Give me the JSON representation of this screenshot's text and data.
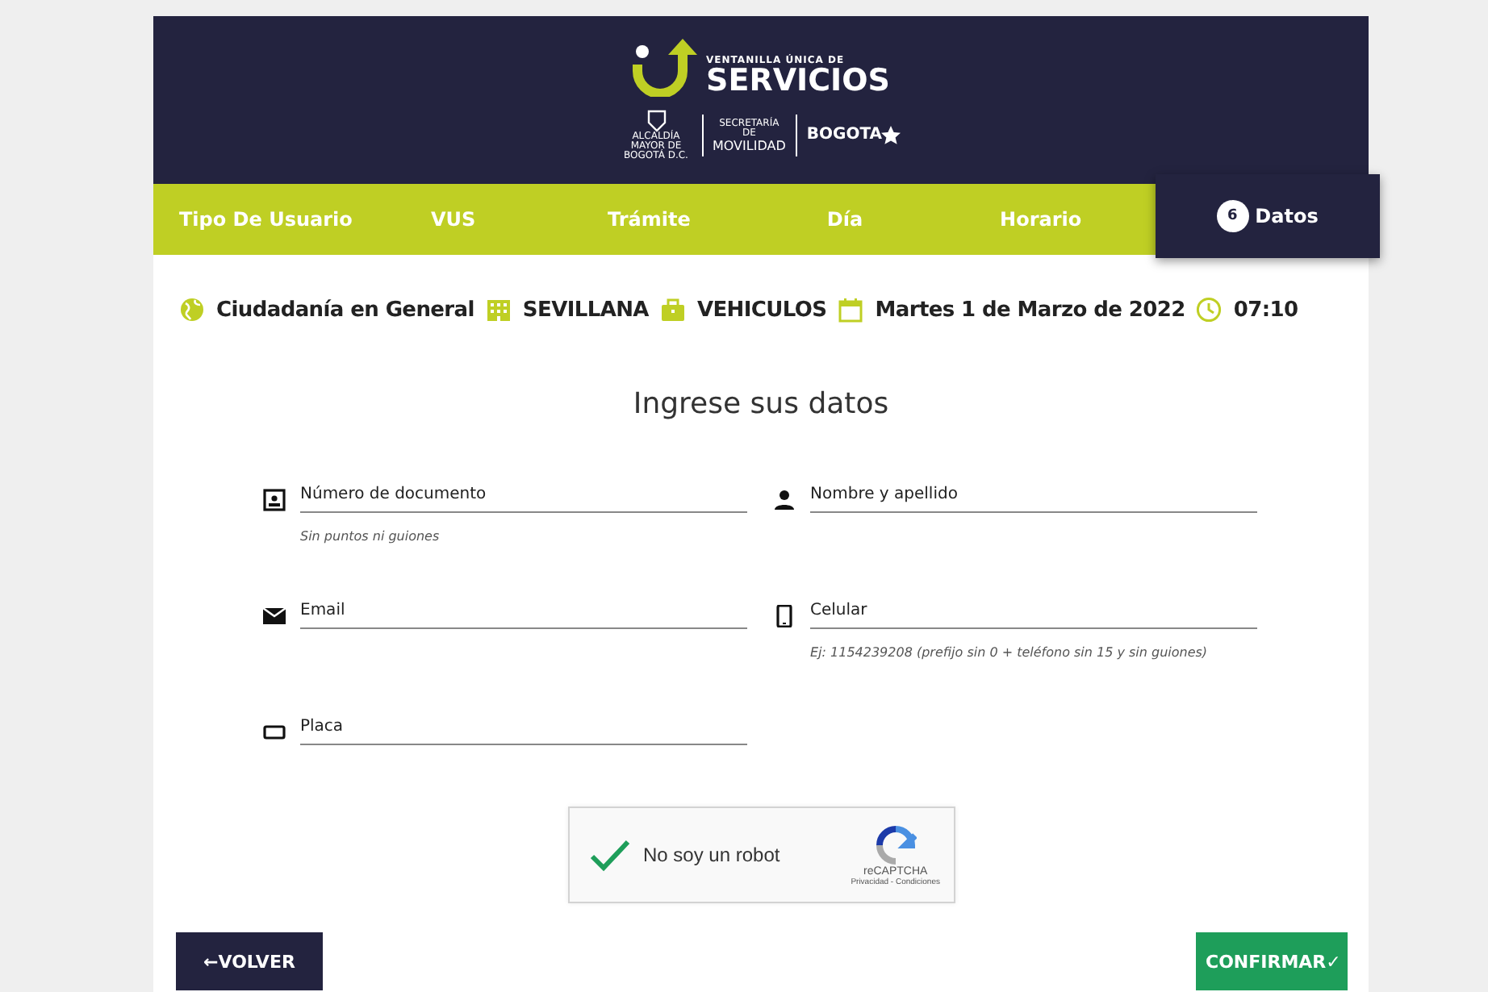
{
  "header": {
    "logo_small": "VENTANILLA ÚNICA DE",
    "logo_big": "SERVICIOS",
    "partner_1": "ALCALDÍA MAYOR DE BOGOTÁ D.C.",
    "partner_2_small": "SECRETARÍA DE",
    "partner_2_big": "MOVILIDAD",
    "partner_3": "BOGOTA"
  },
  "steps": [
    {
      "label": "Tipo De Usuario",
      "selected": false
    },
    {
      "label": "VUS",
      "selected": false
    },
    {
      "label": "Trámite",
      "selected": false
    },
    {
      "label": "Día",
      "selected": false
    },
    {
      "label": "Horario",
      "selected": false
    },
    {
      "label": "Datos",
      "number": "6",
      "selected": true
    }
  ],
  "summary": [
    {
      "kind": "globe",
      "text": "Ciudadanía en General"
    },
    {
      "kind": "building",
      "text": "SEVILLANA"
    },
    {
      "kind": "briefcase",
      "text": "VEHICULOS"
    },
    {
      "kind": "calendar",
      "text": "Martes 1 de Marzo de 2022"
    },
    {
      "kind": "clock",
      "text": "07:10"
    }
  ],
  "form": {
    "title": "Ingrese sus datos",
    "fields": [
      {
        "kind": "id-card",
        "placeholder": "Número de documento",
        "hint": "Sin puntos ni guiones"
      },
      {
        "kind": "person",
        "placeholder": "Nombre y apellido"
      },
      {
        "kind": "mail",
        "placeholder": "Email"
      },
      {
        "kind": "phone",
        "placeholder": "Celular",
        "hint": "Ej: 1154239208 (prefijo sin 0 + teléfono sin 15 y sin guiones)"
      },
      {
        "kind": "plate",
        "placeholder": "Placa"
      }
    ]
  },
  "captcha": {
    "checked": true,
    "label": "No soy un robot",
    "brand": "reCAPTCHA",
    "links": "Privacidad - Condiciones"
  },
  "buttons": {
    "back": "VOLVER",
    "back_icon": "←",
    "confirm": "CONFIRMAR",
    "confirm_icon": "✓"
  }
}
